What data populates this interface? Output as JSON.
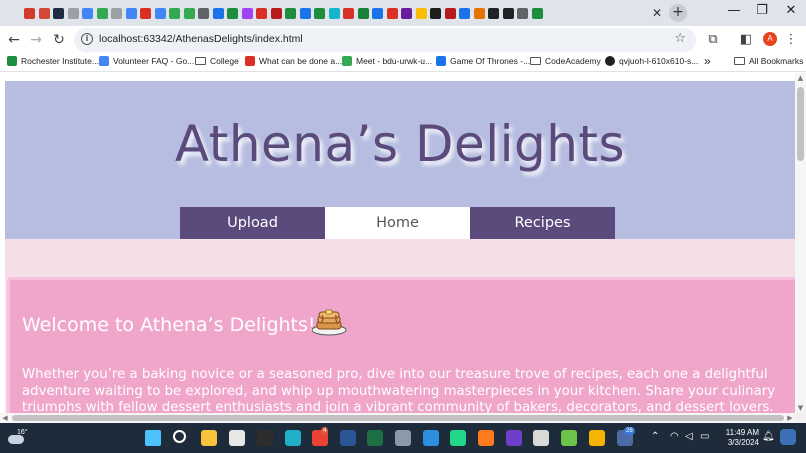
{
  "browser": {
    "favicon_colors": [
      "#d33a2c",
      "#d44638",
      "#1f2a44",
      "#9aa0a6",
      "#4285f4",
      "#34a853",
      "#9aa0a6",
      "#4285f4",
      "#d93025",
      "#4285f4",
      "#34a853",
      "#34a853",
      "#5f6368",
      "#1a73e8",
      "#1e8e3e",
      "#a142f4",
      "#d93025",
      "#b71c1c",
      "#1e8e3e",
      "#1a73e8",
      "#1e8e3e",
      "#12b5cb",
      "#d93025",
      "#188038",
      "#1a73e8",
      "#d93025",
      "#6a1b9a",
      "#fbbc04",
      "#1e1e1e",
      "#b71c1c",
      "#1a73e8",
      "#e37400",
      "#202124",
      "#202124",
      "#5f6368",
      "#1e8e3e"
    ],
    "tab_close_icon": "close-icon",
    "new_tab_icon": "plus-icon",
    "url": "localhost:63342/AthenasDelights/index.html",
    "profile_initial": "A",
    "profile_color": "#e8431a",
    "bookmarks": [
      {
        "label": "Rochester Institute...",
        "icon": "#1e8e3e"
      },
      {
        "label": "Volunteer FAQ - Go...",
        "icon": "#4285f4"
      },
      {
        "label": "College",
        "icon": "folder"
      },
      {
        "label": "What can be done a...",
        "icon": "#d93025"
      },
      {
        "label": "Meet - bdu-urwk-u...",
        "icon": "#34a853"
      },
      {
        "label": "Game Of Thrones -...",
        "icon": "#1a73e8"
      },
      {
        "label": "CodeAcademy",
        "icon": "folder"
      },
      {
        "label": "qvjuoh-l-610x610-s...",
        "icon": "#202124"
      }
    ],
    "bookmarks_overflow": "»",
    "all_bookmarks_label": "All Bookmarks"
  },
  "site": {
    "title": "Athena’s Delights",
    "nav": [
      {
        "label": "Upload",
        "active": false
      },
      {
        "label": "Home",
        "active": true
      },
      {
        "label": "Recipes",
        "active": false
      }
    ],
    "welcome_heading": "Welcome to Athena’s Delights!",
    "welcome_text": "Whether you’re a baking novice or a seasoned pro, dive into our treasure trove of recipes, each one a delightful adventure waiting to be explored, and whip up mouthwatering masterpieces in your kitchen. Share your culinary triumphs with fellow dessert enthusiasts and join a vibrant community of bakers, decorators, and dessert lovers.",
    "colors": {
      "header_bg": "#b6bde0",
      "nav_bg": "#5b4a7c",
      "page_bg": "#f4dfe9",
      "welcome_bg": "#f0a6cb"
    }
  },
  "taskbar": {
    "weather_temp": "16°",
    "apps": [
      {
        "name": "start-icon",
        "color": "#4cc2ff"
      },
      {
        "name": "search-icon",
        "color": "#ffffff"
      },
      {
        "name": "file-explorer-icon",
        "color": "#f8c33a"
      },
      {
        "name": "store-icon",
        "color": "#e8e8e8"
      },
      {
        "name": "terminal-icon",
        "color": "#2d2d2d"
      },
      {
        "name": "edge-icon",
        "color": "#1fb0c7"
      },
      {
        "name": "chrome-icon",
        "color": "#e94235"
      },
      {
        "name": "word-icon",
        "color": "#2b5797"
      },
      {
        "name": "excel-icon",
        "color": "#1d7044"
      },
      {
        "name": "settings-icon",
        "color": "#8a9aa9"
      },
      {
        "name": "vscode-icon",
        "color": "#2d8fe0"
      },
      {
        "name": "pycharm-icon",
        "color": "#21d789"
      },
      {
        "name": "firefox-icon",
        "color": "#ff7a1a"
      },
      {
        "name": "github-icon",
        "color": "#6e40c9"
      },
      {
        "name": "snipping-icon",
        "color": "#d9d9d9"
      },
      {
        "name": "notepad-icon",
        "color": "#6cc24a"
      },
      {
        "name": "chrome-canary-icon",
        "color": "#f4b400"
      },
      {
        "name": "teams-icon",
        "color": "#4b6aa6"
      }
    ],
    "chrome_badge": "4",
    "teams_badge": "28",
    "time": "11:49 AM",
    "date": "3/3/2024"
  }
}
